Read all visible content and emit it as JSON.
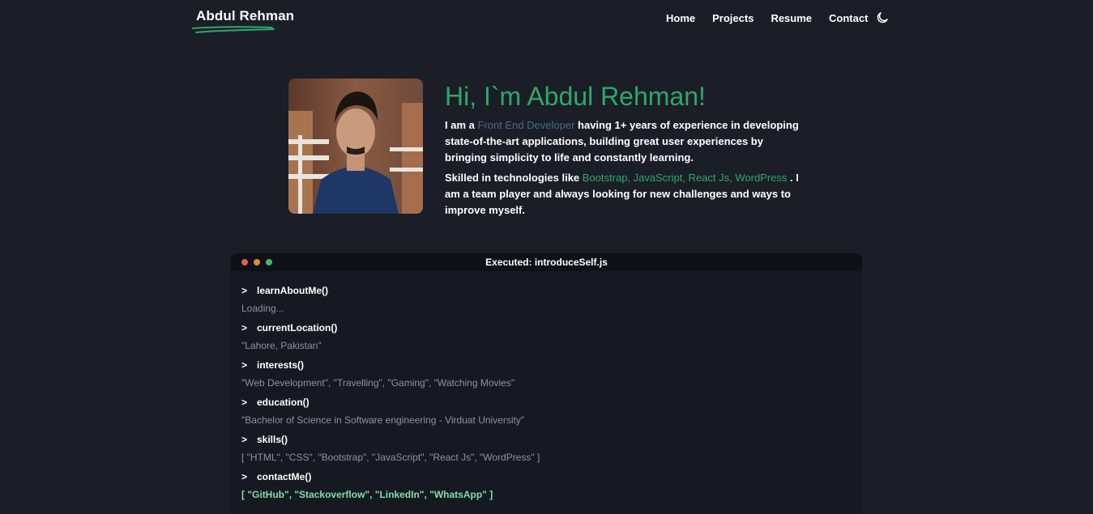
{
  "nav": {
    "logo": "Abdul Rehman",
    "links": [
      "Home",
      "Projects",
      "Resume",
      "Contact"
    ],
    "theme_icon": "moon-icon"
  },
  "hero": {
    "title": "Hi, I`m Abdul Rehman!",
    "p1_prefix": "I am a ",
    "p1_role": "Front End Developer",
    "p1_suffix": " having 1+ years of experience in developing state-of-the-art applications, building great user experiences by bringing simplicity to life and constantly learning.",
    "p2_prefix": "Skilled in technologies like ",
    "p2_tech": "Bootstrap, JavaScript, React Js, WordPress",
    "p2_suffix": " . I am a team player and always looking for new challenges and ways to improve myself."
  },
  "terminal": {
    "title": "Executed: introduceSelf.js",
    "dot_colors": [
      "#e45c5c",
      "#e58b3a",
      "#3fb96f"
    ],
    "entries": [
      {
        "cmd": "learnAboutMe()",
        "output": "Loading..."
      },
      {
        "cmd": "currentLocation()",
        "output": "\"Lahore, Pakistan\""
      },
      {
        "cmd": "interests()",
        "output": "\"Web Development\", \"Travelling\", \"Gaming\", \"Watching Movies\""
      },
      {
        "cmd": "education()",
        "output": "\"Bachelor of Science in Software engineering - Virduat University\""
      },
      {
        "cmd": "skills()",
        "output": "[ \"HTML\", \"CSS\", \"Bootstrap\", \"JavaScript\", \"React Js\", \"WordPress\" ]"
      },
      {
        "cmd": "contactMe()",
        "output": "[ \"GitHub\", \"Stackoverflow\", \"LinkedIn\", \"WhatsApp\" ]"
      }
    ]
  }
}
